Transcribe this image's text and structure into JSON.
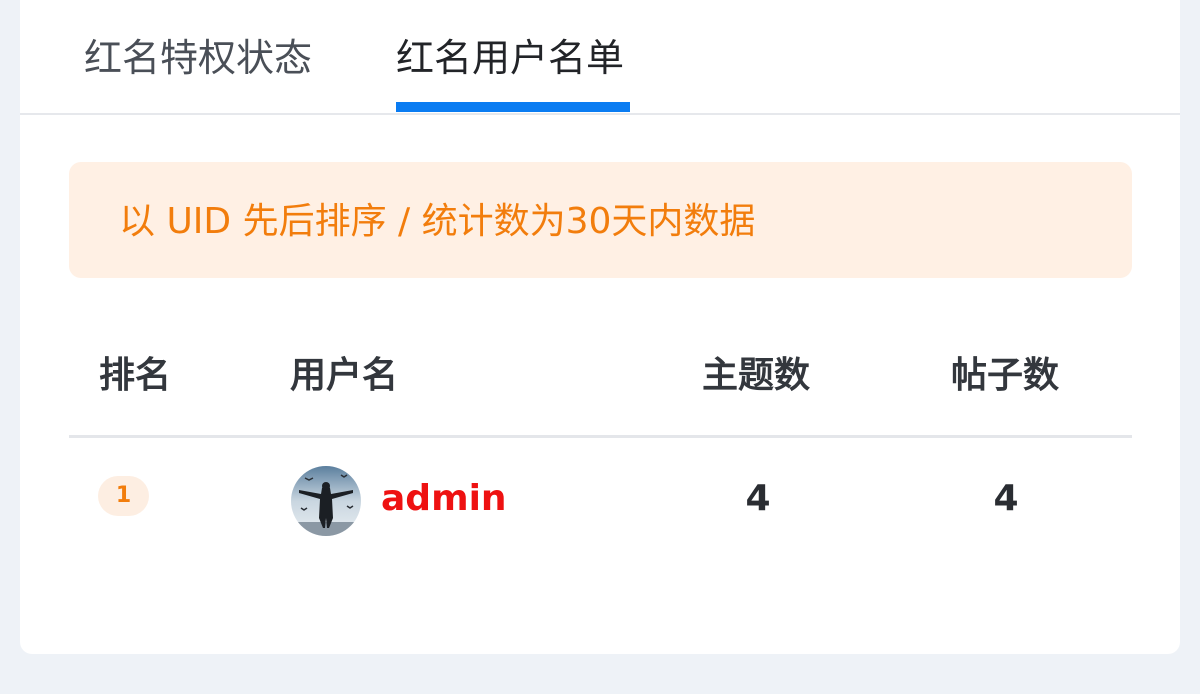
{
  "tabs": [
    {
      "label": "红名特权状态",
      "active": false
    },
    {
      "label": "红名用户名单",
      "active": true
    }
  ],
  "notice": {
    "text": "以 UID 先后排序 / 统计数为30天内数据"
  },
  "table": {
    "headers": {
      "rank": "排名",
      "username": "用户名",
      "topics": "主题数",
      "posts": "帖子数"
    },
    "rows": [
      {
        "rank": "1",
        "username": "admin",
        "topics": "4",
        "posts": "4"
      }
    ]
  },
  "colors": {
    "accent": "#0a7cf2",
    "notice_bg": "#fff0e4",
    "notice_text": "#f27d0c",
    "username_red": "#ee1111",
    "page_bg": "#eef2f7"
  }
}
